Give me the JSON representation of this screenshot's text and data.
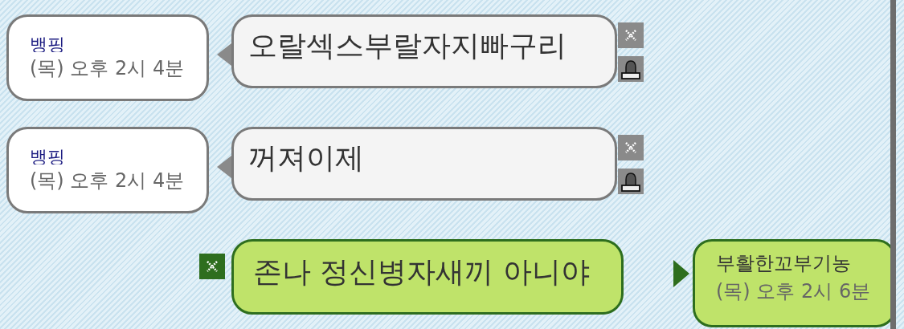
{
  "messages": [
    {
      "kind": "incoming",
      "sender": "뱅핑",
      "time": "(목) 오후 2시 4분",
      "text": "오랄섹스부랄자지빠구리"
    },
    {
      "kind": "incoming",
      "sender": "뱅핑",
      "time": "(목) 오후 2시 4분",
      "text": "꺼져이제"
    },
    {
      "kind": "outgoing",
      "sender": "부활한꼬부기농",
      "time": "(목) 오후 2시 6분",
      "text": "존나 정신병자새끼 아니야"
    }
  ]
}
